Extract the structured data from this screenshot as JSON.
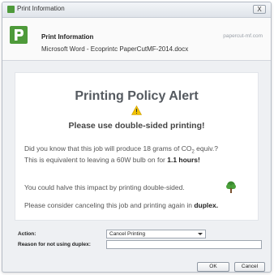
{
  "window": {
    "title": "Print Information",
    "close_label": "X"
  },
  "header": {
    "title": "Print Information",
    "document": "Microsoft Word - Ecoprintc PaperCutMF-2014.docx",
    "brand": "papercut-mf.com"
  },
  "alert": {
    "title": "Printing Policy Alert",
    "subtitle": "Please use double-sided printing!",
    "line1_pre": "Did you know that this job will produce 18 grams of CO",
    "line1_sub": "2",
    "line1_post": " equiv.?",
    "line2_pre": "This is equivalent to leaving a 60W bulb on for ",
    "line2_bold": "1.1 hours!",
    "line3": "You could halve this impact by printing double-sided.",
    "line4_pre": "Please consider canceling this job and printing again in ",
    "line4_bold": "duplex."
  },
  "form": {
    "action_label": "Action:",
    "action_value": "Cancel Printing",
    "reason_label": "Reason for not using duplex:",
    "reason_value": ""
  },
  "buttons": {
    "ok": "OK",
    "cancel": "Cancel"
  },
  "icons": {
    "app": "papercut-logo-icon",
    "warning": "warning-icon",
    "tree": "tree-icon"
  },
  "colors": {
    "brand_green": "#4e9a3a",
    "warning_yellow": "#f2c200"
  }
}
